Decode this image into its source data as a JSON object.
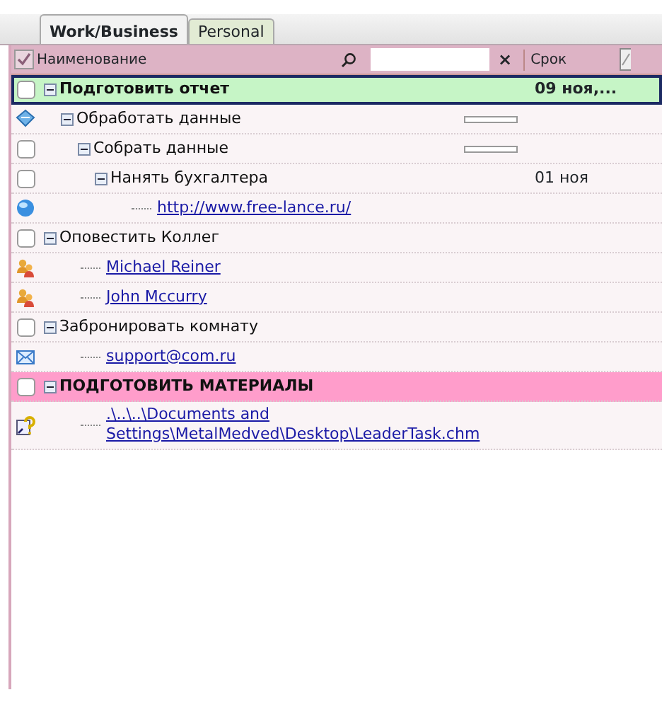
{
  "tabs": [
    {
      "label": "Work/Business",
      "selected": true
    },
    {
      "label": "Personal",
      "selected": false
    }
  ],
  "header": {
    "name_column": "Наименование",
    "search_close": "×",
    "due_column": "Срок"
  },
  "tasks": [
    {
      "kind": "checkbox",
      "title": "Подготовить отчет",
      "bold": true,
      "color": "#c6f5c6",
      "selected": true,
      "checked": false,
      "expanded": true,
      "due": "09 ноя,...",
      "children": [
        {
          "kind": "diamond",
          "title": "Обработать данные",
          "selected": false,
          "expanded": true,
          "level": 0,
          "children": [
            {
              "kind": "checkbox",
              "title": "Собрать данные",
              "selected": false,
              "checked": false,
              "expanded": true,
              "level": 0,
              "children": [
                {
                  "kind": "checkbox",
                  "title": "Нанять бухгалтера",
                  "selected": false,
                  "checked": false,
                  "expanded": true,
                  "due": "01 ноя",
                  "children": [
                    {
                      "kind": "web-link",
                      "title": "http://www.free-lance.ru/",
                      "selected": false
                    }
                  ]
                }
              ]
            }
          ]
        }
      ]
    },
    {
      "kind": "checkbox",
      "title": "Оповестить Коллег",
      "selected": false,
      "checked": false,
      "expanded": true,
      "children": [
        {
          "kind": "contact",
          "title": "Michael Reiner",
          "selected": false
        },
        {
          "kind": "contact",
          "title": "John Mccurry",
          "selected": false
        }
      ]
    },
    {
      "kind": "checkbox",
      "title": "Забронировать комнату",
      "selected": false,
      "checked": false,
      "expanded": true,
      "children": [
        {
          "kind": "email",
          "title": "support@com.ru",
          "selected": false
        }
      ]
    },
    {
      "kind": "checkbox",
      "title": "ПОДГОТОВИТЬ МАТЕРИАЛЫ",
      "bold": true,
      "color": "#ff9dcb",
      "selected": false,
      "checked": false,
      "expanded": true,
      "children": [
        {
          "kind": "file",
          "title": ".\\..\\..\\Documents and Settings\\MetalMedved\\Desktop\\LeaderTask.chm",
          "selected": false
        }
      ]
    }
  ]
}
